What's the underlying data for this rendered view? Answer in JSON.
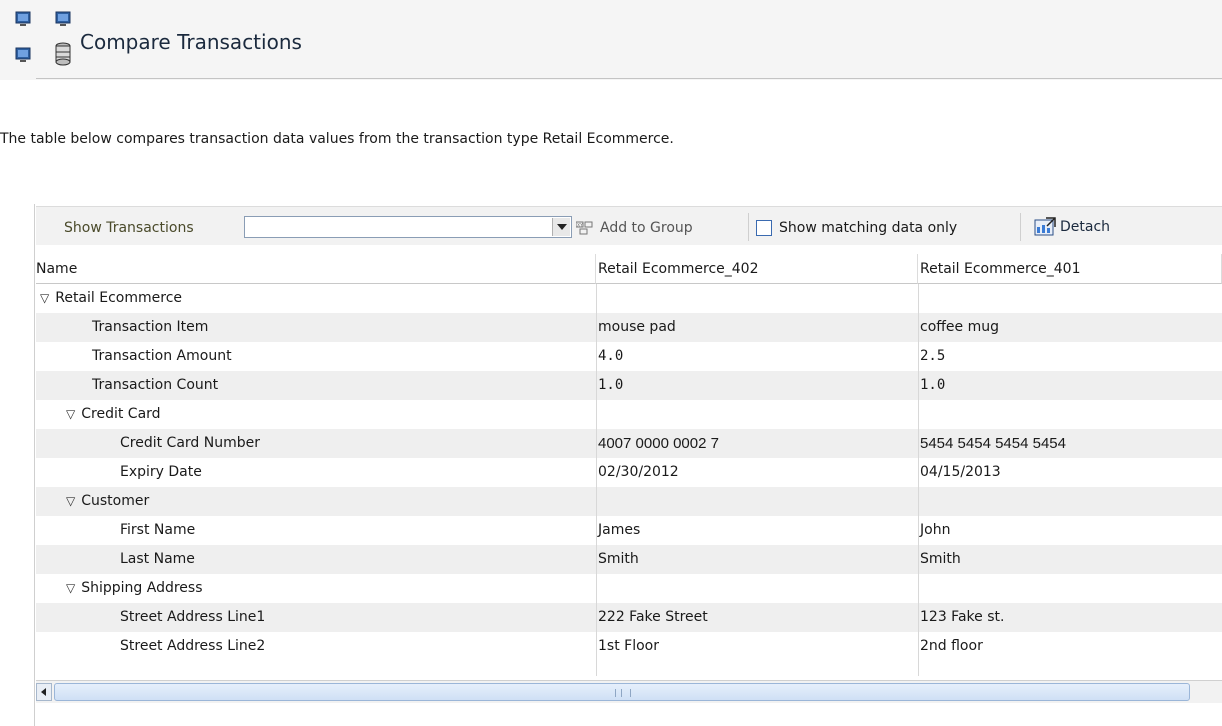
{
  "page": {
    "title": "Compare Transactions",
    "description": "The table below compares transaction data values from the transaction type Retail Ecommerce."
  },
  "toolbar": {
    "show_transactions_label": "Show Transactions",
    "show_transactions_value": "",
    "add_to_group_label": "Add to Group",
    "show_matching_label": "Show matching data only",
    "show_matching_checked": false,
    "detach_label": "Detach"
  },
  "table": {
    "columns": [
      "Name",
      "Retail Ecommerce_402",
      "Retail Ecommerce_401"
    ],
    "rows": [
      {
        "name": "Retail Ecommerce",
        "v402": "",
        "v401": ""
      },
      {
        "name": "Transaction Item",
        "v402": "mouse pad",
        "v401": "coffee mug"
      },
      {
        "name": "Transaction Amount",
        "v402": "4.0",
        "v401": "2.5"
      },
      {
        "name": "Transaction Count",
        "v402": "1.0",
        "v401": "1.0"
      },
      {
        "name": "Credit Card",
        "v402": "",
        "v401": ""
      },
      {
        "name": "Credit Card Number",
        "v402": "4007 0000 0002 7",
        "v401": "5454 5454 5454 5454"
      },
      {
        "name": "Expiry Date",
        "v402": "02/30/2012",
        "v401": "04/15/2013"
      },
      {
        "name": "Customer",
        "v402": "",
        "v401": ""
      },
      {
        "name": "First Name",
        "v402": "James",
        "v401": "John"
      },
      {
        "name": "Last Name",
        "v402": "Smith",
        "v401": "Smith"
      },
      {
        "name": "Shipping Address",
        "v402": "",
        "v401": ""
      },
      {
        "name": "Street Address Line1",
        "v402": "222 Fake Street",
        "v401": "123 Fake st."
      },
      {
        "name": "Street Address Line2",
        "v402": "1st Floor",
        "v401": "2nd floor"
      }
    ]
  },
  "icons": {
    "header": "monitors-database-icon",
    "add_to_group": "add-to-group-icon",
    "detach": "detach-icon",
    "expand": "expanded-triangle-icon"
  },
  "colors": {
    "title": "#1b2a3e",
    "alt_row": "#efefef",
    "scroll_thumb": "#cfe0f5"
  }
}
